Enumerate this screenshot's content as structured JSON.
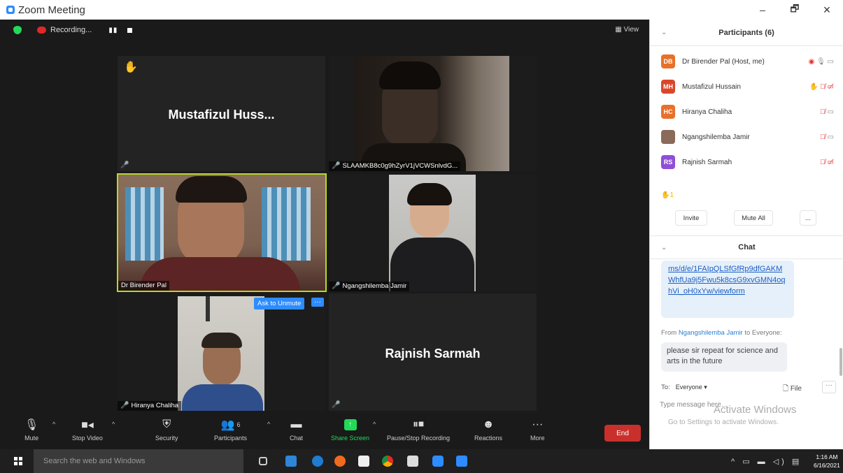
{
  "window": {
    "title": "Zoom Meeting",
    "minimize": "–",
    "maximize": "🗗",
    "close": "×"
  },
  "top_strip": {
    "recording_label": "Recording...",
    "pause_glyph": "▮▮",
    "view_label": "View"
  },
  "tiles": {
    "t1": {
      "big_name": "Mustafizul  Huss...",
      "hand": "✋"
    },
    "t2": {
      "name": "SLAAMKB8c0g9hZyrV1jVCWSnlvdG..."
    },
    "t3": {
      "name": "Dr Birender Pal"
    },
    "t4": {
      "name": "Ngangshilemba Jamir"
    },
    "t5": {
      "name": "Hiranya Chaliha",
      "ask_unmute": "Ask to Unmute",
      "more": "···"
    },
    "t6": {
      "big_name": "Rajnish Sarmah"
    }
  },
  "toolbar": {
    "mute": "Mute",
    "stop_video": "Stop Video",
    "security": "Security",
    "participants": "Participants",
    "participants_count": "6",
    "chat": "Chat",
    "share_screen": "Share Screen",
    "pause_stop": "Pause/Stop Recording",
    "reactions": "Reactions",
    "more": "More",
    "end": "End"
  },
  "participants_panel": {
    "title": "Participants (6)",
    "list": [
      {
        "initials": "DB",
        "name": "Dr Birender Pal (Host, me)",
        "color": "#e8702a"
      },
      {
        "initials": "MH",
        "name": "Mustafizul Hussain",
        "color": "#d9472b"
      },
      {
        "initials": "HC",
        "name": "Hiranya Chaliha",
        "color": "#e8702a"
      },
      {
        "initials": "",
        "name": "Ngangshilemba Jamir",
        "color": "#8a6a58"
      },
      {
        "initials": "RS",
        "name": "Rajnish Sarmah",
        "color": "#8f4fd6"
      }
    ],
    "raised_hands": "✋1",
    "invite": "Invite",
    "mute_all": "Mute All",
    "more": "..."
  },
  "chat_panel": {
    "title": "Chat",
    "link_message": "ms/d/e/1FAIpQLSfGfRp9dfGAKMWhfUa9j5Fwu5k8csG9xvGMN4oqhVi_oH0xYw/viewform",
    "from_prefix": "From ",
    "from_sender": "Ngangshilemba Jamir",
    "from_suffix": " to Everyone:",
    "message": "please sir repeat for science and arts in the future",
    "to_label": "To:",
    "to_value": "Everyone ▾",
    "file_label": "File",
    "more": "···",
    "input_placeholder": "Type message here..."
  },
  "watermark": {
    "line1": "Activate Windows",
    "line2": "Go to Settings to activate Windows."
  },
  "taskbar": {
    "search_placeholder": "Search the web and Windows",
    "tray_icons": "^ ▭ ▬ ◁) ▤",
    "time": "1:16 AM",
    "date": "6/16/2021"
  }
}
